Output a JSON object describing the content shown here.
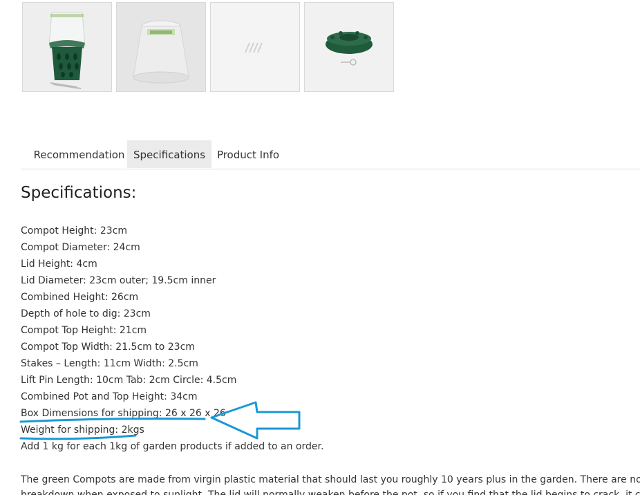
{
  "thumbnails": [
    {
      "icon": "compot-with-lid-photo-icon"
    },
    {
      "icon": "clear-lid-photo-icon"
    },
    {
      "icon": "stakes-photo-icon"
    },
    {
      "icon": "green-tray-photo-icon"
    }
  ],
  "tabs": [
    {
      "label": "Recommendation",
      "active": false
    },
    {
      "label": "Specifications",
      "active": true
    },
    {
      "label": "Product Info",
      "active": false
    }
  ],
  "content": {
    "heading": "Specifications:",
    "specs": [
      "Compot Height: 23cm",
      "Compot Diameter: 24cm",
      "Lid Height: 4cm",
      "Lid Diameter: 23cm outer; 19.5cm inner",
      "Combined Height: 26cm",
      "Depth of hole to dig: 23cm",
      "Compot Top Height: 21cm",
      "Compot Top Width: 21.5cm to 23cm",
      "Stakes – Length: 11cm Width: 2.5cm",
      "Lift Pin Length: 10cm Tab: 2cm Circle: 4.5cm",
      "Combined Pot and Top Height: 34cm",
      "Box Dimensions for shipping: 26 x 26 x 26",
      "Weight for shipping: 2kgs",
      "Add 1 kg for each 1kg of garden products if added to an order."
    ],
    "paragraph_line1": "The green Compots are made from virgin plastic material that should last you roughly 10 years plus in the garden. There are no harmful ch",
    "paragraph_line2": "breakdown when exposed to sunlight. The lid will normally weaken before the pot, so if you find that the lid begins to crack, it can be"
  },
  "colors": {
    "annotation": "#1a98d5",
    "active_tab": "#ebebeb",
    "text": "#333333",
    "compot_green": "#1f5a3c"
  }
}
